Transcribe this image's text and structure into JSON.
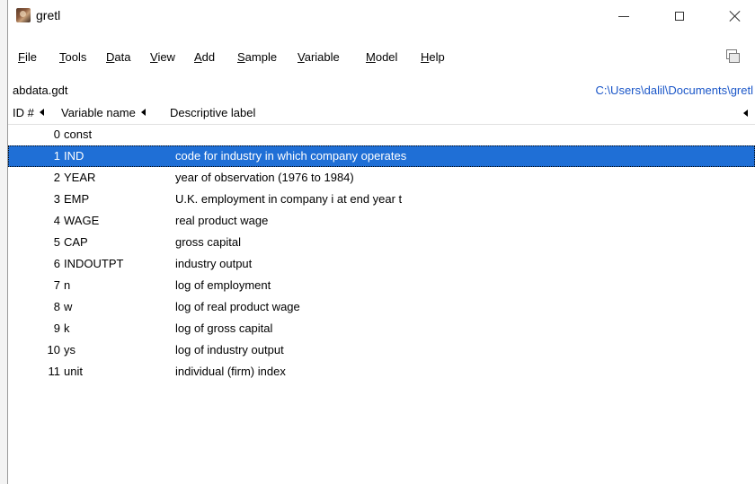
{
  "window": {
    "title": "gretl",
    "icon": "gretl-app-icon"
  },
  "menu": [
    {
      "mnemonic": "F",
      "rest": "ile"
    },
    {
      "mnemonic": "T",
      "rest": "ools"
    },
    {
      "mnemonic": "D",
      "rest": "ata"
    },
    {
      "mnemonic": "V",
      "rest": "iew"
    },
    {
      "mnemonic": "A",
      "rest": "dd"
    },
    {
      "mnemonic": "S",
      "rest": "ample"
    },
    {
      "mnemonic": "V",
      "rest": "ariable"
    },
    {
      "mnemonic": "M",
      "rest": "odel"
    },
    {
      "mnemonic": "H",
      "rest": "elp"
    }
  ],
  "info": {
    "filename": "abdata.gdt",
    "path": "C:\\Users\\dalil\\Documents\\gretl"
  },
  "columns": {
    "id": "ID #",
    "name": "Variable name",
    "label": "Descriptive label"
  },
  "variables": [
    {
      "id": "0",
      "name": "const",
      "label": ""
    },
    {
      "id": "1",
      "name": "IND",
      "label": "code for industry in which company operates"
    },
    {
      "id": "2",
      "name": "YEAR",
      "label": "year of observation (1976 to 1984)"
    },
    {
      "id": "3",
      "name": "EMP",
      "label": "U.K. employment in company i at end year t"
    },
    {
      "id": "4",
      "name": "WAGE",
      "label": "real product wage"
    },
    {
      "id": "5",
      "name": "CAP",
      "label": "gross capital"
    },
    {
      "id": "6",
      "name": "INDOUTPT",
      "label": "industry output"
    },
    {
      "id": "7",
      "name": "n",
      "label": "log of employment"
    },
    {
      "id": "8",
      "name": "w",
      "label": "log of real product wage"
    },
    {
      "id": "9",
      "name": "k",
      "label": "log of gross capital"
    },
    {
      "id": "10",
      "name": "ys",
      "label": "log of industry output"
    },
    {
      "id": "11",
      "name": "unit",
      "label": "individual (firm) index"
    }
  ],
  "selected_id": "1",
  "colors": {
    "selection": "#1f6fd6",
    "path_link": "#1a56c8"
  }
}
